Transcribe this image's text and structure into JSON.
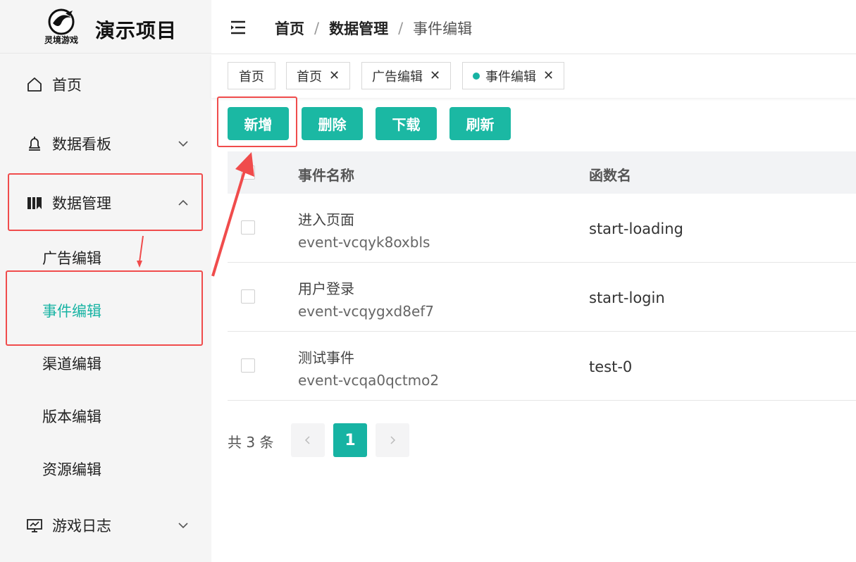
{
  "app": {
    "title": "演示项目",
    "logo_text": "灵境游戏"
  },
  "colors": {
    "accent": "#17b3a3",
    "annotation": "#f04c4c"
  },
  "sidebar": {
    "items": [
      {
        "label": "首页",
        "icon": "home-icon"
      },
      {
        "label": "数据看板",
        "icon": "bell-icon",
        "expandable": true
      },
      {
        "label": "数据管理",
        "icon": "book-icon",
        "expandable": true,
        "expanded": true
      },
      {
        "label": "游戏日志",
        "icon": "monitor-icon",
        "expandable": true
      }
    ],
    "sub_items": [
      {
        "label": "广告编辑"
      },
      {
        "label": "事件编辑",
        "active": true
      },
      {
        "label": "渠道编辑"
      },
      {
        "label": "版本编辑"
      },
      {
        "label": "资源编辑"
      }
    ]
  },
  "header": {
    "breadcrumb": [
      "首页",
      "数据管理",
      "事件编辑"
    ],
    "separator": "/"
  },
  "tags": [
    {
      "label": "首页",
      "closable": false
    },
    {
      "label": "首页",
      "closable": true
    },
    {
      "label": "广告编辑",
      "closable": true
    },
    {
      "label": "事件编辑",
      "closable": true,
      "active": true
    }
  ],
  "toolbar": {
    "add": "新增",
    "delete": "删除",
    "download": "下载",
    "refresh": "刷新"
  },
  "table": {
    "columns": [
      "事件名称",
      "函数名"
    ],
    "rows": [
      {
        "name": "进入页面",
        "id": "event-vcqyk8oxbls",
        "function": "start-loading"
      },
      {
        "name": "用户登录",
        "id": "event-vcqygxd8ef7",
        "function": "start-login"
      },
      {
        "name": "测试事件",
        "id": "event-vcqa0qctmo2",
        "function": "test-0"
      }
    ]
  },
  "pagination": {
    "total_text": "共 3 条",
    "current_page": "1"
  }
}
